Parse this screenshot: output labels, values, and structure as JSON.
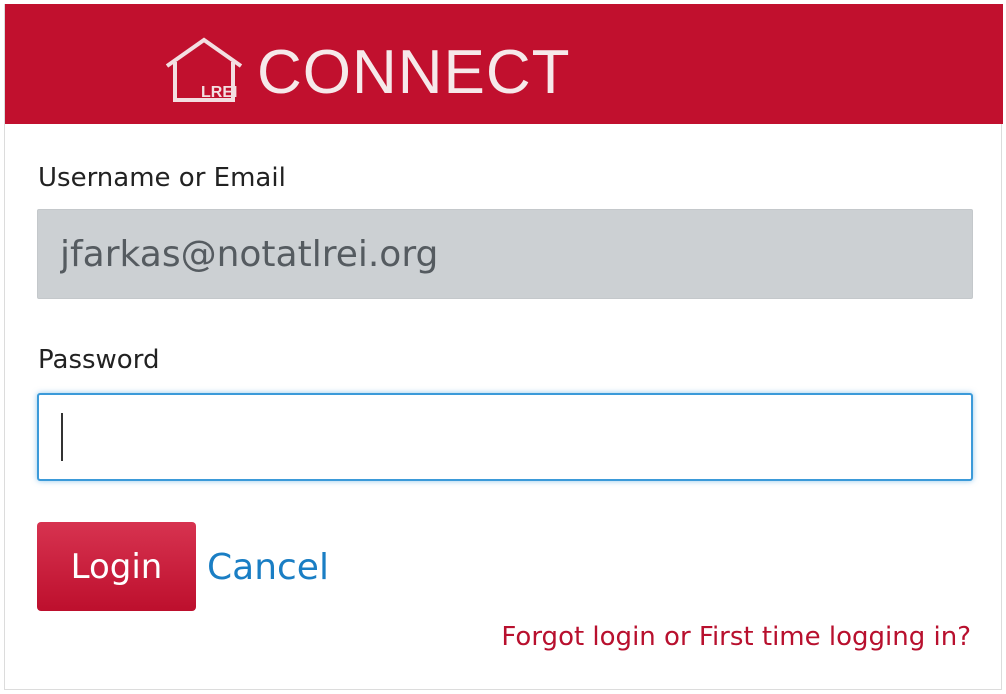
{
  "header": {
    "logo_text": "CONNECT",
    "logo_icon_text": "LREI",
    "background_color": "#c1102e"
  },
  "form": {
    "username_label": "Username or Email",
    "username_value": "jfarkas@notatlrei.org",
    "password_label": "Password",
    "password_value": "",
    "login_label": "Login",
    "cancel_label": "Cancel",
    "forgot_label": "Forgot login or First time logging in?"
  },
  "colors": {
    "accent": "#c1102e",
    "link": "#1a7ec4",
    "focus": "#3b9ad9"
  }
}
